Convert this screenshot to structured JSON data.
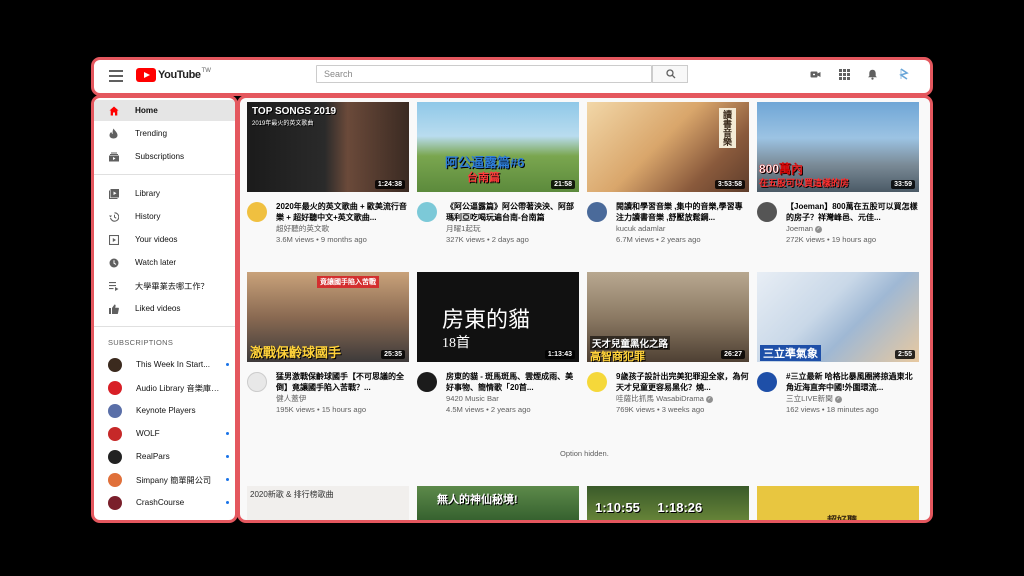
{
  "header": {
    "logo_text": "YouTube",
    "logo_region": "TW",
    "search_placeholder": "Search"
  },
  "sidebar": {
    "main": [
      {
        "label": "Home",
        "icon": "home-icon",
        "active": true
      },
      {
        "label": "Trending",
        "icon": "flame-icon"
      },
      {
        "label": "Subscriptions",
        "icon": "subscriptions-icon"
      }
    ],
    "library": [
      {
        "label": "Library",
        "icon": "library-icon"
      },
      {
        "label": "History",
        "icon": "history-icon"
      },
      {
        "label": "Your videos",
        "icon": "your-videos-icon"
      },
      {
        "label": "Watch later",
        "icon": "clock-icon"
      },
      {
        "label": "大學畢業去哪工作？",
        "icon": "playlist-icon"
      },
      {
        "label": "Liked videos",
        "icon": "thumbs-up-icon"
      }
    ],
    "subscriptions_heading": "SUBSCRIPTIONS",
    "subscriptions": [
      {
        "label": "This Week In Start...",
        "color": "#3b2a1e"
      },
      {
        "label": "Audio Library 音樂庫 ...",
        "color": "#d81f26"
      },
      {
        "label": "Keynote Players",
        "color": "#5a6fa8"
      },
      {
        "label": "WOLF",
        "color": "#c62828"
      },
      {
        "label": "RealPars",
        "color": "#222222"
      },
      {
        "label": "Simpany 簡單開公司",
        "color": "#e0703a"
      },
      {
        "label": "CrashCourse",
        "color": "#7a1f2b"
      }
    ]
  },
  "videos": [
    {
      "title": "2020年最火的英文歌曲 + 歐美流行音樂 + 超好聽中文+英文歌曲...",
      "channel": "超好聽的英文歌",
      "stats": "3.6M views • 9 months ago",
      "duration": "1:24:38",
      "overlay": "TOP SONGS 2019",
      "overlay2": "2019年最火的英文歌曲",
      "verified": false
    },
    {
      "title": "《阿公逼露篇》阿公帶著泱泱、阿部瑪利亞吃喝玩遍台南-台南篇",
      "channel": "月曜1起玩",
      "stats": "327K views • 2 days ago",
      "duration": "21:58",
      "overlay": "阿公逼露篇#6",
      "overlay2": "台南篇",
      "verified": false
    },
    {
      "title": "閱讀和學習音樂 ,集中的音樂,學習專注力讀書音樂 ,舒壓放鬆鋼...",
      "channel": "kucuk adamlar",
      "stats": "6.7M views • 2 years ago",
      "duration": "3:53:58",
      "overlay": "讀書音樂",
      "overlay2": "",
      "verified": false
    },
    {
      "title": "【Joeman】800萬在五股可以買怎樣的房子？祥灣峰邑、元佳...",
      "channel": "Joeman",
      "stats": "272K views • 19 hours ago",
      "duration": "33:59",
      "overlay": "800萬內",
      "overlay2": "在五股可以買這樣的房",
      "verified": true
    },
    {
      "title": "猛男激戰保齡球國手【不可思議的全倒】竟讓國手陷入苦戰？...",
      "channel": "健人蓋伊",
      "stats": "195K views • 15 hours ago",
      "duration": "25:35",
      "overlay": "激戰保齡球國手",
      "overlay2": "竟讓國手陷入苦戰",
      "verified": false
    },
    {
      "title": "房東的貓 - 斑馬斑馬、雲煙成雨、美好事物、簡情歌「20首...",
      "channel": "9420 Music Bar",
      "stats": "4.5M views • 2 years ago",
      "duration": "1:13:43",
      "overlay": "房東的貓",
      "overlay2": "18首",
      "verified": false
    },
    {
      "title": "9歲孩子設計出完美犯罪迎全家，為何天才兒童更容易黑化？燒...",
      "channel": "哇薩比抓馬 WasabiDrama",
      "stats": "769K views • 3 weeks ago",
      "duration": "26:27",
      "overlay": "天才兒童黑化之路",
      "overlay2": "高智商犯罪",
      "verified": true
    },
    {
      "title": "#三立最新 哈格比暴風圈將掠過東北角近海直奔中國!外圍環流...",
      "channel": "三立LIVE新聞",
      "stats": "162 views • 18 minutes ago",
      "duration": "2:55",
      "overlay": "三立準氣象",
      "overlay2": "",
      "verified": true
    }
  ],
  "option_hidden": "Option hidden.",
  "bottom_row": [
    {
      "overlay": "2020新歌 & 排行榜歌曲"
    },
    {
      "overlay": "無人的神仙秘境!"
    },
    {
      "overlay": "1:10:55 1:18:26"
    },
    {
      "overlay": "超好聽"
    }
  ]
}
